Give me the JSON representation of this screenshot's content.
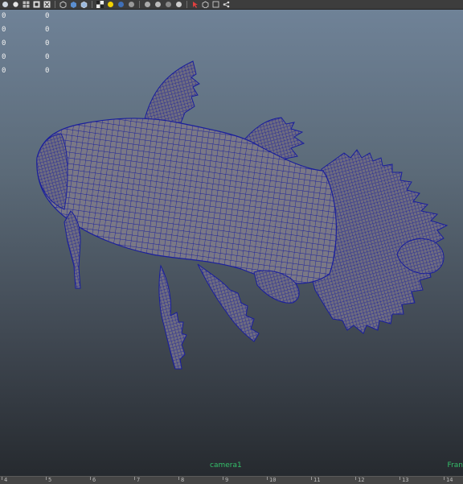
{
  "toolbar": {
    "icons": [
      "select-camera-icon",
      "lock-camera-icon",
      "grid-icon",
      "film-gate-icon",
      "resolution-gate-icon",
      "wireframe-cube-icon",
      "smooth-shade-cube-icon",
      "textured-cube-icon",
      "checker-icon",
      "light-icon",
      "sphere-shade-icon",
      "shadow-sphere-icon",
      "ambient-occlusion-icon",
      "motion-blur-icon",
      "xray-icon",
      "isolate-icon",
      "frame-all-icon",
      "frame-selected-icon",
      "share-icon"
    ]
  },
  "hud": {
    "rows": [
      {
        "a": "0",
        "b": "0"
      },
      {
        "a": "0",
        "b": "0"
      },
      {
        "a": "0",
        "b": "0"
      },
      {
        "a": "0",
        "b": "0"
      },
      {
        "a": "0",
        "b": "0"
      }
    ]
  },
  "viewport": {
    "camera_label": "camera1",
    "frame_label": "Fran"
  },
  "timeline": {
    "ticks": [
      "4",
      "5",
      "6",
      "7",
      "8",
      "9",
      "10",
      "11",
      "12",
      "13",
      "14"
    ]
  },
  "colors": {
    "wire": "#1a1f9c",
    "mesh_fill": "#7a7886",
    "hud_text": "#f2f2f2",
    "cam_label": "#34c06a"
  }
}
